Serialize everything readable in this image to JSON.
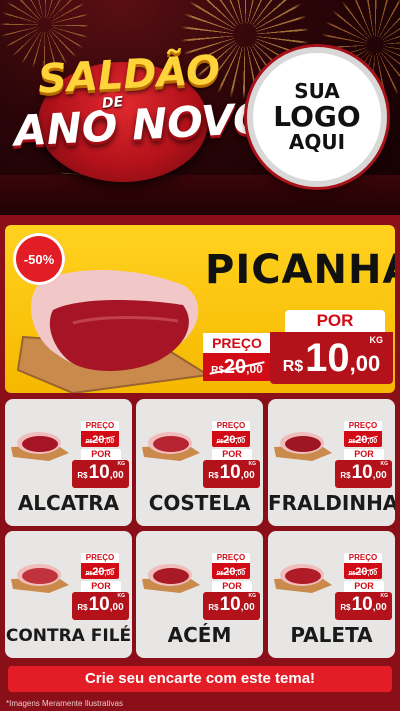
{
  "header": {
    "title_line1": "SALDÃO",
    "title_connector": "DE",
    "title_line2": "ANO NOVO",
    "logo_line1": "SUA",
    "logo_line2": "LOGO",
    "logo_line3": "AQUI"
  },
  "featured": {
    "name": "PICANHA",
    "badge": "-50%",
    "preco_label": "PREÇO",
    "old_currency": "R$",
    "old_int": "20",
    "old_dec": ",00",
    "por_label": "POR",
    "currency": "R$",
    "price_int": "10",
    "price_dec": ",00",
    "unit": "KG"
  },
  "products": [
    {
      "name": "ALCATRA",
      "preco_label": "PREÇO",
      "old_currency": "R$",
      "old_int": "20",
      "old_dec": ",00",
      "por_label": "POR",
      "currency": "R$",
      "price_int": "10",
      "price_dec": ",00",
      "unit": "KG"
    },
    {
      "name": "COSTELA",
      "preco_label": "PREÇO",
      "old_currency": "R$",
      "old_int": "20",
      "old_dec": ",00",
      "por_label": "POR",
      "currency": "R$",
      "price_int": "10",
      "price_dec": ",00",
      "unit": "KG"
    },
    {
      "name": "FRALDINHA",
      "preco_label": "PREÇO",
      "old_currency": "R$",
      "old_int": "20",
      "old_dec": ",00",
      "por_label": "POR",
      "currency": "R$",
      "price_int": "10",
      "price_dec": ",00",
      "unit": "KG"
    },
    {
      "name": "CONTRA FILÉ",
      "preco_label": "PREÇO",
      "old_currency": "R$",
      "old_int": "20",
      "old_dec": ",00",
      "por_label": "POR",
      "currency": "R$",
      "price_int": "10",
      "price_dec": ",00",
      "unit": "KG"
    },
    {
      "name": "ACÉM",
      "preco_label": "PREÇO",
      "old_currency": "R$",
      "old_int": "20",
      "old_dec": ",00",
      "por_label": "POR",
      "currency": "R$",
      "price_int": "10",
      "price_dec": ",00",
      "unit": "KG"
    },
    {
      "name": "PALETA",
      "preco_label": "PREÇO",
      "old_currency": "R$",
      "old_int": "20",
      "old_dec": ",00",
      "por_label": "POR",
      "currency": "R$",
      "price_int": "10",
      "price_dec": ",00",
      "unit": "KG"
    }
  ],
  "footer": {
    "cta_label": "Crie seu encarte com este tema!",
    "disclaimer": "*Imagens Meramente Ilustrativas"
  },
  "colors": {
    "background": "#8a0f18",
    "accent_red": "#e31d26",
    "price_red": "#b3121b",
    "featured_yellow": "#ffd21f",
    "card_gray": "#e8e6e4"
  },
  "icons": [
    "firework-icon",
    "meat-icon",
    "cutting-board-icon"
  ]
}
